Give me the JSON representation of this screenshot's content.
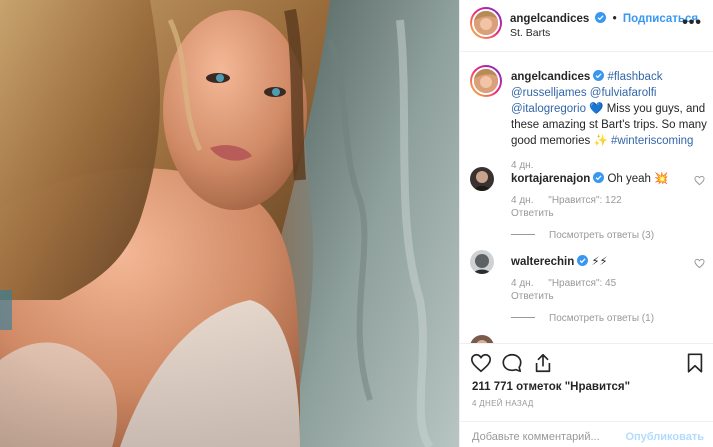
{
  "post": {
    "author": "angelcandices",
    "location": "St. Barts",
    "follow_label": "Подписаться",
    "dot": "•",
    "more": "•••"
  },
  "caption": {
    "author": "angelcandices",
    "hashtag1": "#flashback",
    "mention1": "@russelljames",
    "mention2": "@fulviafarolfi",
    "mention3": "@italogregorio",
    "emoji_heart": "💙",
    "body": "Miss you guys, and these amazing st Bart's trips. So many good memories",
    "emoji_sparkle": "✨",
    "hashtag2": "#winteriscoming",
    "time": "4 дн."
  },
  "comments": [
    {
      "author": "kortajarenajon",
      "text": "Oh yeah 💥",
      "time": "4 дн.",
      "likes": "\"Нравится\": 122",
      "reply": "Ответить",
      "view_replies": "Посмотреть ответы (3)"
    },
    {
      "author": "walterechin",
      "text": "⚡⚡",
      "time": "4 дн.",
      "likes": "\"Нравится\": 45",
      "reply": "Ответить",
      "view_replies": "Посмотреть ответы (1)"
    }
  ],
  "actions": {
    "likes_count": "211 771 отметок \"Нравится\"",
    "posted_ago": "4 ДНЕЙ НАЗАД",
    "comment_placeholder": "Добавьте комментарий...",
    "post_button": "Опубликовать"
  },
  "colors": {
    "link": "#3366a8",
    "follow": "#3897f0",
    "verified": "#3897f0",
    "muted": "#999999",
    "post_disabled": "#b3dbff"
  },
  "icons": {
    "like": "heart-outline",
    "comment": "speech-bubble",
    "share": "share-arrow",
    "save": "bookmark",
    "verified": "verified-badge",
    "more": "ellipsis"
  }
}
